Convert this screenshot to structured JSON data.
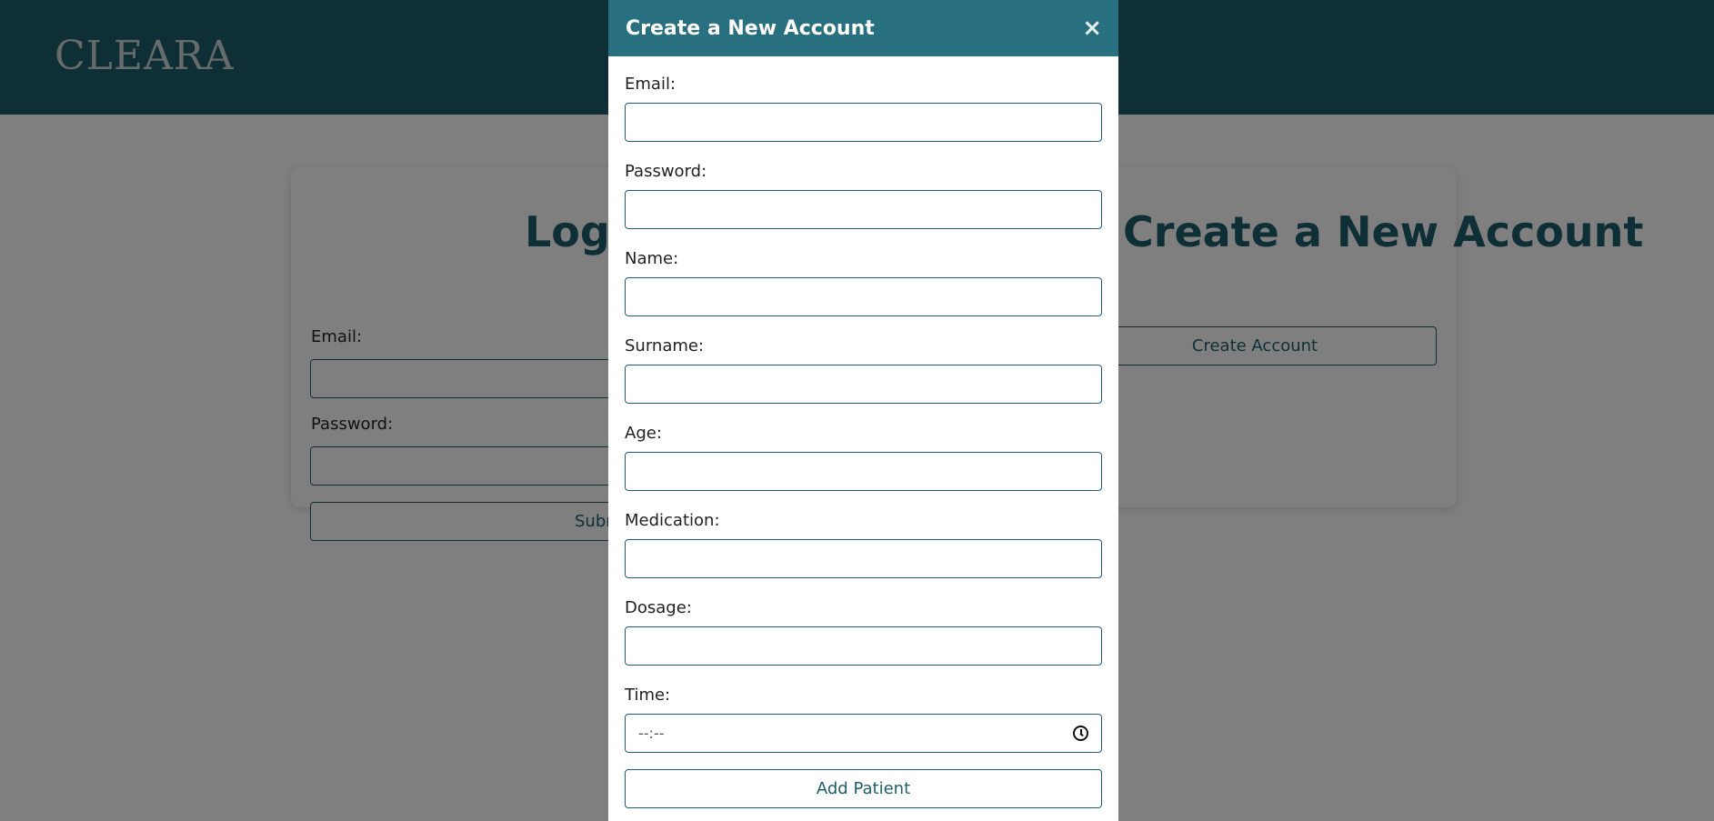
{
  "app": {
    "logo_text": "CLEARA"
  },
  "login": {
    "title": "Log in",
    "email_label": "Email:",
    "password_label": "Password:",
    "submit_label": "Submit"
  },
  "new_account_panel": {
    "title": "Create a New Account",
    "button_label": "Create Account"
  },
  "modal": {
    "title": "Create a New Account",
    "close_symbol": "×",
    "fields": {
      "email_label": "Email:",
      "password_label": "Password:",
      "name_label": "Name:",
      "surname_label": "Surname:",
      "age_label": "Age:",
      "medication_label": "Medication:",
      "dosage_label": "Dosage:",
      "time_label": "Time:",
      "time_placeholder": "--:--"
    },
    "add_button_label": "Add Patient"
  },
  "colors": {
    "primary": "#1f5e6c",
    "modal_header": "#286f7f",
    "overlay": "rgba(0,0,0,0.5)"
  }
}
